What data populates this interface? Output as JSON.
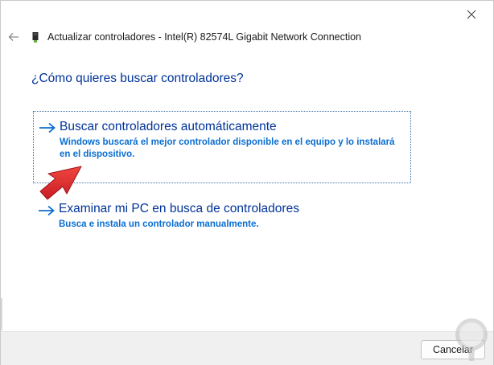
{
  "window": {
    "title": "Actualizar controladores - Intel(R) 82574L Gigabit Network Connection",
    "back_icon": "arrow-left-icon",
    "device_icon": "network-adapter-icon",
    "close_icon": "close-icon"
  },
  "main": {
    "question": "¿Cómo quieres buscar controladores?",
    "options": [
      {
        "title": "Buscar controladores automáticamente",
        "description": "Windows buscará el mejor controlador disponible en el equipo y lo instalará en el dispositivo.",
        "icon": "arrow-right-icon"
      },
      {
        "title": "Examinar mi PC en busca de controladores",
        "description": "Busca e instala un controlador manualmente.",
        "icon": "arrow-right-icon"
      }
    ]
  },
  "footer": {
    "cancel_label": "Cancelar"
  },
  "colors": {
    "heading_blue": "#003399",
    "description_blue": "#0a6ed1",
    "annotation_arrow_red": "#e3262e",
    "footer_bg": "#f0f0f0"
  }
}
